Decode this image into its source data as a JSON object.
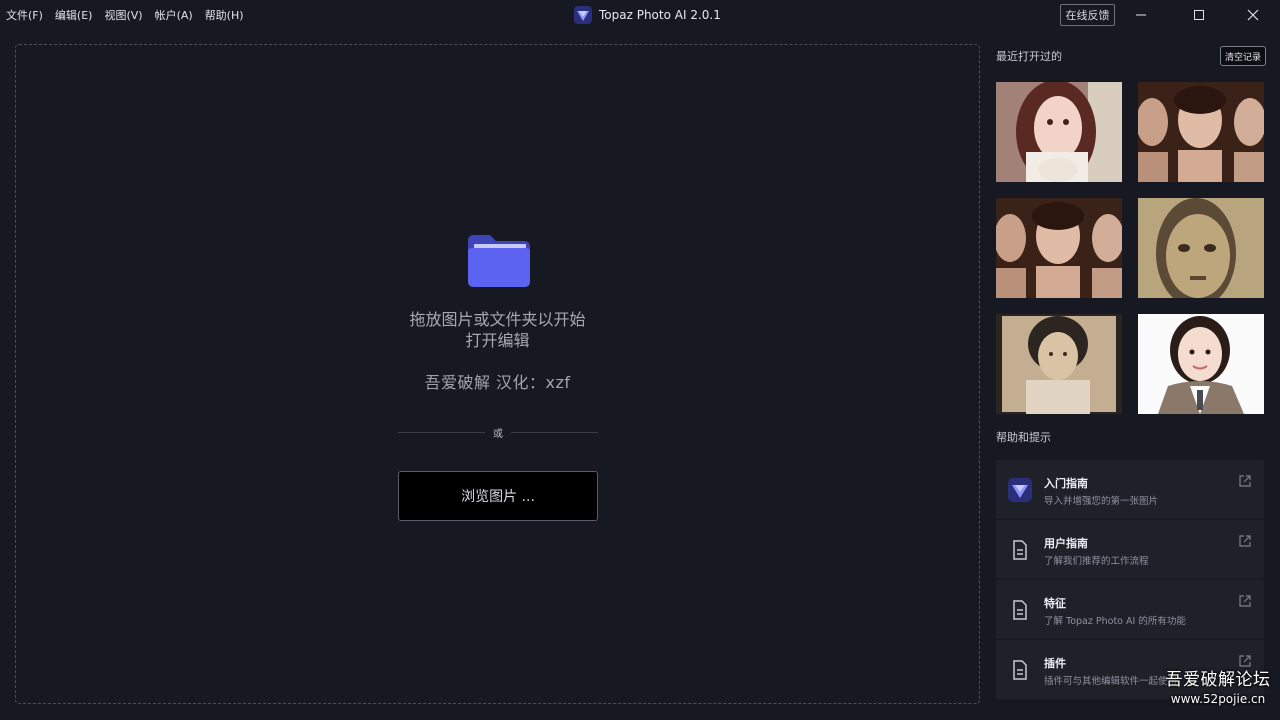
{
  "menu": [
    {
      "label": "文件(F)"
    },
    {
      "label": "编辑(E)"
    },
    {
      "label": "视图(V)"
    },
    {
      "label": "帐户(A)"
    },
    {
      "label": "帮助(H)"
    }
  ],
  "app": {
    "title": "Topaz Photo AI 2.0.1",
    "feedback_label": "在线反馈",
    "icons": {
      "minimize": "minimize-icon",
      "maximize": "maximize-icon",
      "close": "close-icon"
    }
  },
  "dropzone": {
    "line1": "拖放图片或文件夹以开始",
    "line2": "打开编辑",
    "credit": "吾爱破解  汉化：xzf",
    "or_label": "或",
    "browse_label": "浏览图片 ...",
    "folder_color": "#5b63f0"
  },
  "recent": {
    "title": "最近打开过的",
    "clear_label": "清空记录"
  },
  "help": {
    "title": "帮助和提示",
    "items": [
      {
        "title": "入门指南",
        "desc": "导入并增强您的第一张图片",
        "icon": "topaz-logo-icon"
      },
      {
        "title": "用户指南",
        "desc": "了解我们推荐的工作流程",
        "icon": "document-icon"
      },
      {
        "title": "特征",
        "desc": "了解 Topaz Photo AI 的所有功能",
        "icon": "document-icon"
      },
      {
        "title": "插件",
        "desc": "插件可与其他编辑软件一起使用",
        "icon": "document-icon"
      }
    ]
  },
  "watermark": {
    "line1": "吾爱破解论坛",
    "line2": "www.52pojie.cn"
  },
  "colors": {
    "background": "#171922",
    "accent": "#5b63f0",
    "card": "#1f2129"
  }
}
